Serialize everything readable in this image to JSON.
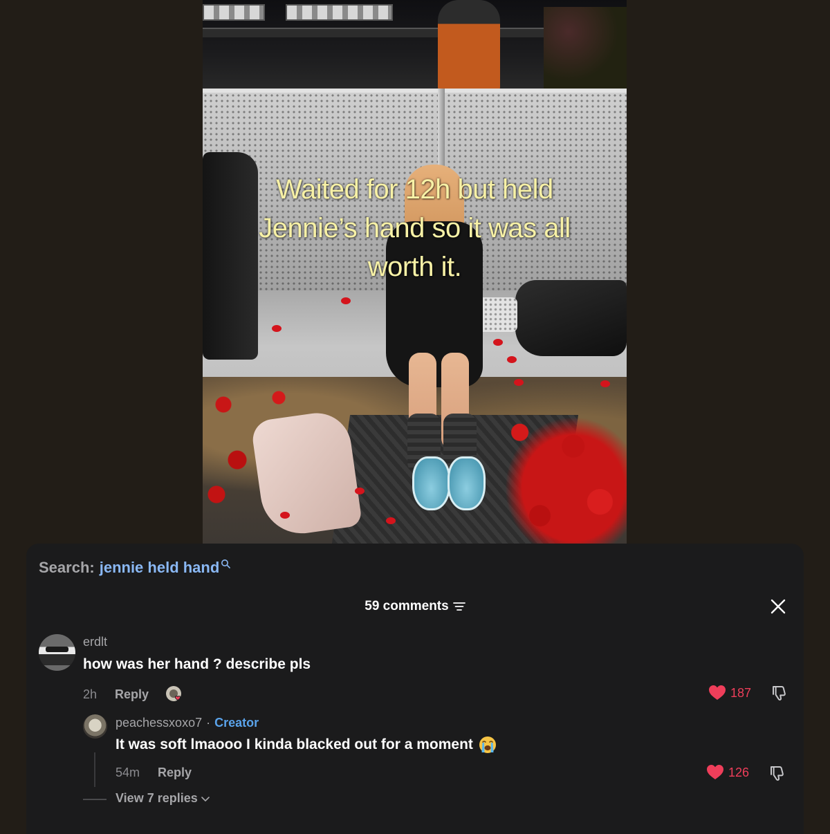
{
  "video": {
    "caption_lines": [
      "Waited for 12h but held",
      "Jennie’s hand so it was all",
      "worth it."
    ]
  },
  "search": {
    "label": "Search:",
    "term": "jennie held hand"
  },
  "comments_header": {
    "count_label": "59 comments"
  },
  "comments": [
    {
      "username": "erdlt",
      "text": "how was her hand ? describe pls",
      "time": "2h",
      "reply_label": "Reply",
      "likes": "187"
    }
  ],
  "reply": {
    "username": "peachessxoxo7",
    "separator": "·",
    "badge": "Creator",
    "text": "It was soft lmaooo I kinda blacked out for a moment",
    "time": "54m",
    "reply_label": "Reply",
    "likes": "126"
  },
  "view_replies": "View 7 replies",
  "colors": {
    "background": "#221d17",
    "panel": "#1b1b1c",
    "search_term": "#8ab8f4",
    "creator_badge": "#5aa3ea",
    "like_red": "#ef3e5a",
    "caption_yellow": "#f7f1a6"
  },
  "icons": [
    "search-icon",
    "filter-icon",
    "close-icon",
    "heart-icon",
    "dislike-icon",
    "chevron-down-icon",
    "crying-emoji-icon"
  ]
}
